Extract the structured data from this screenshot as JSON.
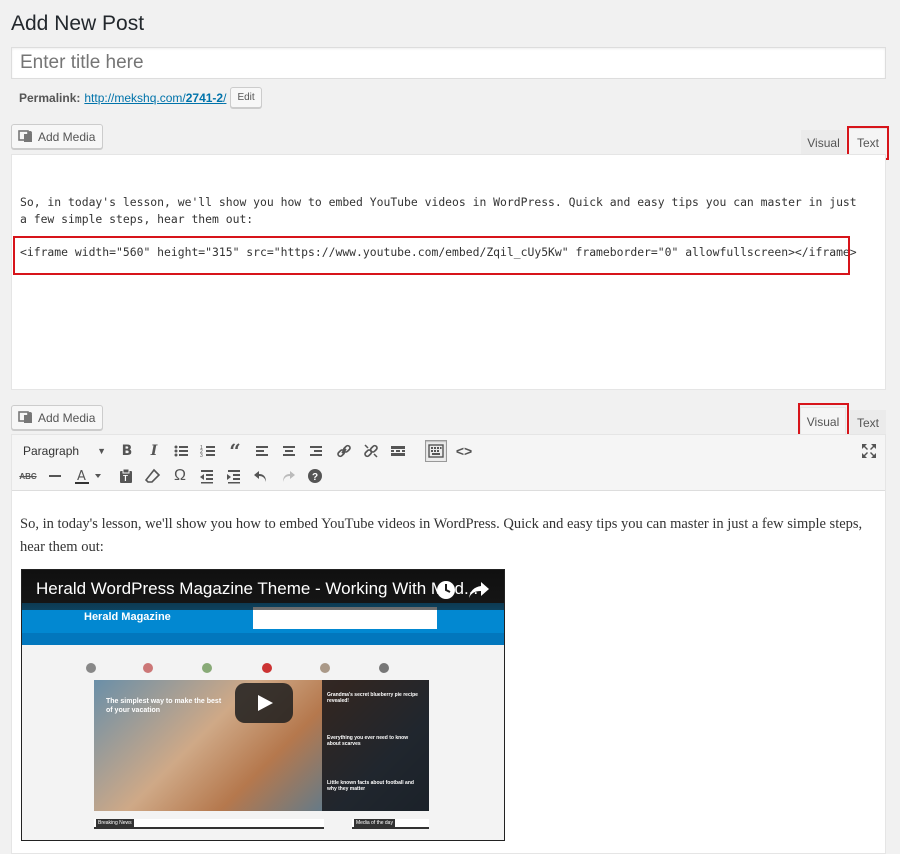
{
  "page": {
    "title": "Add New Post"
  },
  "title_field": {
    "placeholder": "Enter title here"
  },
  "permalink": {
    "label": "Permalink:",
    "url_base": "http://mekshq.com/",
    "slug": "2741-2",
    "url_tail": "/",
    "edit_label": "Edit"
  },
  "text_editor": {
    "add_media_label": "Add Media",
    "tab_visual": "Visual",
    "tab_text": "Text",
    "active_tab": "Text",
    "paragraph": "So, in today's lesson, we'll show you how to embed YouTube videos in WordPress. Quick and easy tips you can master in just a few simple steps, hear them out:",
    "iframe_code": "<iframe width=\"560\" height=\"315\" src=\"https://www.youtube.com/embed/Zqil_cUy5Kw\" frameborder=\"0\" allowfullscreen></iframe>"
  },
  "visual_editor": {
    "add_media_label": "Add Media",
    "tab_visual": "Visual",
    "tab_text": "Text",
    "active_tab": "Visual",
    "format_select": "Paragraph",
    "toolbar_row1": [
      "bold-icon",
      "italic-icon",
      "bulleted-list-icon",
      "numbered-list-icon",
      "blockquote-icon",
      "align-left-icon",
      "align-center-icon",
      "align-right-icon",
      "insert-link-icon",
      "remove-link-icon",
      "read-more-icon",
      "toolbar-toggle-icon",
      "code-icon"
    ],
    "toolbar_row2": [
      "strikethrough-icon",
      "horizontal-line-icon",
      "text-color-icon",
      "paste-as-text-icon",
      "clear-formatting-icon",
      "special-character-icon",
      "decrease-indent-icon",
      "increase-indent-icon",
      "undo-icon",
      "redo-icon",
      "help-icon"
    ],
    "fullscreen_icon": "distraction-free-icon",
    "paragraph": "So, in today's lesson, we'll show you how to embed YouTube videos in WordPress. Quick and easy tips you can master in just a few simple steps, hear them out:",
    "video": {
      "title": "Herald WordPress Magazine Theme - Working With Mod...",
      "site_logo": "Herald Magazine",
      "hero_headline": "The simplest way to make the best of your vacation",
      "side_headlines": [
        "Grandma's secret blueberry pie recipe revealed!",
        "Everything you ever need to know about scarves",
        "Little known facts about football and why they matter"
      ],
      "section_left": "Breaking News",
      "section_right": "Media of the day"
    }
  },
  "highlight_color": "#d7141a"
}
